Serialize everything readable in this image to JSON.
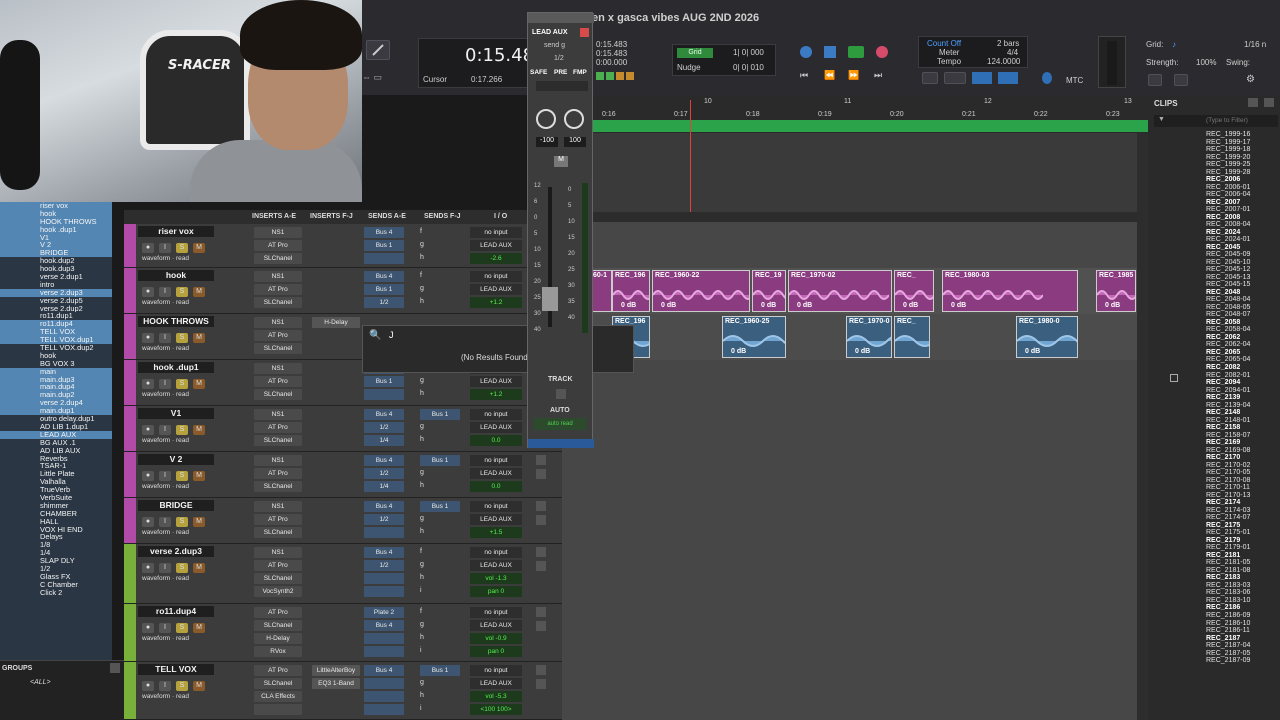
{
  "session_title": "en x gasca vibes AUG 2ND 2026",
  "webcam": {
    "chair_text": "S-RACER"
  },
  "transport": {
    "main_counter": "0:15.48",
    "cursor_label": "Cursor",
    "cursor_value": "0:17.266",
    "sub_counters": [
      "0:15.483",
      "0:15.483",
      "0:00.000"
    ],
    "grid_label": "Grid",
    "grid_value": "1| 0| 000",
    "nudge_label": "Nudge",
    "nudge_value": "0| 0| 010",
    "count_off": "Count Off",
    "meter_label": "Meter",
    "tempo_label": "Tempo",
    "bars": "2 bars",
    "meter": "4/4",
    "tempo": "124.0000",
    "mtc": "MTC",
    "grid_right": "Grid:",
    "grid_right_value": "1/16 n",
    "strength_label": "Strength:",
    "strength": "100%",
    "swing_label": "Swing:"
  },
  "ruler": {
    "ticks": [
      "0:16",
      "0:17",
      "0:18",
      "0:19",
      "0:20",
      "0:21",
      "0:22",
      "0:23"
    ],
    "bars": [
      "10",
      "11",
      "12",
      "13"
    ]
  },
  "aux_window": {
    "name": "LEAD AUX",
    "send": "send g",
    "ch": "1/2",
    "tabs": [
      "SAFE",
      "PRE",
      "FMP"
    ],
    "pan_left": "-100",
    "pan_right": "100",
    "mute": "M",
    "scale": [
      "12",
      "6",
      "0",
      "5",
      "10",
      "15",
      "20",
      "25",
      "30",
      "40"
    ],
    "meter_scale": [
      "0",
      "5",
      "10",
      "15",
      "20",
      "25",
      "30",
      "35",
      "40"
    ],
    "track": "TRACK",
    "auto": "AUTO",
    "auto_mode": "auto read"
  },
  "search_popup": {
    "query": "J",
    "result": "(No Results Found)"
  },
  "mix_headers": [
    "INSERTS A-E",
    "INSERTS F-J",
    "SENDS A-E",
    "SENDS F-J",
    "I / O"
  ],
  "tracks": [
    {
      "name": "riser vox",
      "color": "#b24aa8",
      "inserts": [
        "NS1",
        "AT Pro",
        "SLChanel"
      ],
      "ins_fj": [],
      "sends": [
        "Bus 4",
        "Bus 1",
        ""
      ],
      "send_letters": [
        "f",
        "g",
        "h"
      ],
      "sends_fj": [],
      "io": [
        "no input",
        "LEAD AUX"
      ],
      "vol": "-2.6",
      "pan": "0"
    },
    {
      "name": "hook",
      "color": "#b24aa8",
      "inserts": [
        "NS1",
        "AT Pro",
        "SLChanel"
      ],
      "ins_fj": [],
      "sends": [
        "Bus 4",
        "Bus 1",
        "1/2"
      ],
      "send_letters": [
        "f",
        "g",
        "h"
      ],
      "sends_fj": [],
      "io": [
        "no input",
        "LEAD AUX"
      ],
      "vol": "+1.2",
      "pan": "0"
    },
    {
      "name": "HOOK THROWS",
      "color": "#b24aa8",
      "inserts": [
        "NS1",
        "AT Pro",
        "SLChanel"
      ],
      "ins_fj": [
        "H-Delay"
      ],
      "sends": [],
      "send_letters": [],
      "sends_fj": [],
      "io": [],
      "vol": "",
      "pan": ""
    },
    {
      "name": "hook .dup1",
      "color": "#b24aa8",
      "inserts": [
        "NS1",
        "AT Pro",
        "SLChanel"
      ],
      "ins_fj": [],
      "sends": [
        "",
        "Bus 1",
        ""
      ],
      "send_letters": [
        "f",
        "g",
        "h"
      ],
      "sends_fj": [],
      "io": [
        "",
        "LEAD AUX"
      ],
      "vol": "+1.2",
      "pan": "0"
    },
    {
      "name": "V1",
      "color": "#b24aa8",
      "inserts": [
        "NS1",
        "AT Pro",
        "SLChanel"
      ],
      "ins_fj": [],
      "sends": [
        "Bus 4",
        "1/2",
        "1/4"
      ],
      "send_letters": [
        "f",
        "g",
        "h"
      ],
      "sends_fj": [
        "Bus 1"
      ],
      "io": [
        "no input",
        "LEAD AUX"
      ],
      "vol": "0.0",
      "pan": "0"
    },
    {
      "name": "V 2",
      "color": "#b24aa8",
      "inserts": [
        "NS1",
        "AT Pro",
        "SLChanel"
      ],
      "ins_fj": [],
      "sends": [
        "Bus 4",
        "1/2",
        "1/4"
      ],
      "send_letters": [
        "f",
        "g",
        "h"
      ],
      "sends_fj": [
        "Bus 1"
      ],
      "io": [
        "no input",
        "LEAD AUX"
      ],
      "vol": "0.0",
      "pan": "0"
    },
    {
      "name": "BRIDGE",
      "color": "#b24aa8",
      "inserts": [
        "NS1",
        "AT Pro",
        "SLChanel"
      ],
      "ins_fj": [],
      "sends": [
        "Bus 4",
        "1/2",
        ""
      ],
      "send_letters": [
        "f",
        "g",
        "h"
      ],
      "sends_fj": [
        "Bus 1"
      ],
      "io": [
        "no input",
        "LEAD AUX"
      ],
      "vol": "+1.5",
      "pan": "0"
    },
    {
      "name": "verse 2.dup3",
      "color": "#79b03a",
      "inserts": [
        "NS1",
        "AT Pro",
        "SLChanel",
        "VocSynth2"
      ],
      "ins_fj": [],
      "sends": [
        "Bus 4",
        "1/2",
        "",
        ""
      ],
      "send_letters": [
        "f",
        "g",
        "h",
        "i"
      ],
      "sends_fj": [],
      "io": [
        "no input",
        "LEAD AUX"
      ],
      "vol": "vol -1.3",
      "pan": "pan 0"
    },
    {
      "name": "ro11.dup4",
      "color": "#79b03a",
      "inserts": [
        "AT Pro",
        "SLChanel",
        "H-Delay",
        "RVox"
      ],
      "ins_fj": [],
      "sends": [
        "Plate 2",
        "Bus 4",
        "",
        ""
      ],
      "send_letters": [
        "f",
        "g",
        "h",
        "i"
      ],
      "sends_fj": [],
      "io": [
        "no input",
        "LEAD AUX"
      ],
      "vol": "vol -0.9",
      "pan": "pan 0"
    },
    {
      "name": "TELL VOX",
      "color": "#79b03a",
      "inserts": [
        "AT Pro",
        "SLChanel",
        "CLA Effects",
        ""
      ],
      "ins_fj": [
        "LittleAlterBoy",
        "EQ3 1-Band"
      ],
      "sends": [
        "Bus 4",
        "",
        "",
        ""
      ],
      "send_letters": [
        "f",
        "g",
        "h",
        "i"
      ],
      "sends_fj": [
        "Bus 1"
      ],
      "io": [
        "no input",
        "LEAD AUX"
      ],
      "vol": "vol -5.3",
      "pan": "<100 100>"
    }
  ],
  "tracklist": [
    {
      "t": "riser vox",
      "s": true
    },
    {
      "t": "hook",
      "s": true
    },
    {
      "t": "HOOK THROWS",
      "s": true
    },
    {
      "t": "hook .dup1",
      "s": true
    },
    {
      "t": "V1",
      "s": true
    },
    {
      "t": "V 2",
      "s": true
    },
    {
      "t": "BRIDGE",
      "s": true
    },
    {
      "t": "hook.dup2",
      "s": false
    },
    {
      "t": "hook.dup3",
      "s": false
    },
    {
      "t": "verse 2.dup1",
      "s": false
    },
    {
      "t": "intro",
      "s": false
    },
    {
      "t": "verse 2.dup3",
      "s": true
    },
    {
      "t": "verse 2.dup5",
      "s": false
    },
    {
      "t": "verse 2.dup2",
      "s": false
    },
    {
      "t": "ro11.dup1",
      "s": false
    },
    {
      "t": "ro11.dup4",
      "s": true
    },
    {
      "t": "TELL VOX",
      "s": true
    },
    {
      "t": "TELL VOX.dup1",
      "s": true
    },
    {
      "t": "TELL VOX.dup2",
      "s": false
    },
    {
      "t": "hook",
      "s": false
    },
    {
      "t": "BG VOX 3",
      "s": false
    },
    {
      "t": "main",
      "s": true
    },
    {
      "t": "main.dup3",
      "s": true
    },
    {
      "t": "main.dup4",
      "s": true
    },
    {
      "t": "main.dup2",
      "s": true
    },
    {
      "t": "verse 2.dup4",
      "s": true
    },
    {
      "t": "main.dup1",
      "s": true
    },
    {
      "t": "outro delay.dup1",
      "s": false
    },
    {
      "t": "AD LIB 1.dup1",
      "s": false
    },
    {
      "t": "LEAD AUX",
      "s": true
    },
    {
      "t": "BG AUX .1",
      "s": false
    },
    {
      "t": "AD LIB AUX",
      "s": false
    },
    {
      "t": "Reverbs",
      "s": false
    },
    {
      "t": "TSAR-1",
      "s": false
    },
    {
      "t": "Little Plate",
      "s": false
    },
    {
      "t": "Valhalla",
      "s": false
    },
    {
      "t": "TrueVerb",
      "s": false
    },
    {
      "t": "VerbSuite",
      "s": false
    },
    {
      "t": "shimmer",
      "s": false
    },
    {
      "t": "CHAMBER",
      "s": false
    },
    {
      "t": "HALL",
      "s": false
    },
    {
      "t": "VOX HI END",
      "s": false
    },
    {
      "t": "Delays",
      "s": false
    },
    {
      "t": "1/8",
      "s": false
    },
    {
      "t": "1/4",
      "s": false
    },
    {
      "t": "SLAP DLY",
      "s": false
    },
    {
      "t": "1/2",
      "s": false
    },
    {
      "t": "Glass FX",
      "s": false
    },
    {
      "t": "C Chamber",
      "s": false
    },
    {
      "t": "Click 2",
      "s": false
    }
  ],
  "groups": {
    "title": "GROUPS",
    "all": "<ALL>"
  },
  "clips_panel": {
    "title": "CLIPS",
    "filter_placeholder": "(Type to Filter)",
    "items": [
      {
        "t": "REC_1999-16",
        "b": false
      },
      {
        "t": "REC_1999-17",
        "b": false
      },
      {
        "t": "REC_1999-18",
        "b": false
      },
      {
        "t": "REC_1999-20",
        "b": false
      },
      {
        "t": "REC_1999-25",
        "b": false
      },
      {
        "t": "REC_1999-28",
        "b": false
      },
      {
        "t": "REC_2006",
        "b": true
      },
      {
        "t": "REC_2006-01",
        "b": false
      },
      {
        "t": "REC_2006-04",
        "b": false
      },
      {
        "t": "REC_2007",
        "b": true
      },
      {
        "t": "REC_2007-01",
        "b": false
      },
      {
        "t": "REC_2008",
        "b": true
      },
      {
        "t": "REC_2008-04",
        "b": false
      },
      {
        "t": "REC_2024",
        "b": true
      },
      {
        "t": "REC_2024-01",
        "b": false
      },
      {
        "t": "REC_2045",
        "b": true
      },
      {
        "t": "REC_2045-09",
        "b": false
      },
      {
        "t": "REC_2045-10",
        "b": false
      },
      {
        "t": "REC_2045-12",
        "b": false
      },
      {
        "t": "REC_2045-13",
        "b": false
      },
      {
        "t": "REC_2045-15",
        "b": false
      },
      {
        "t": "REC_2048",
        "b": true
      },
      {
        "t": "REC_2048-04",
        "b": false
      },
      {
        "t": "REC_2048-05",
        "b": false
      },
      {
        "t": "REC_2048-07",
        "b": false
      },
      {
        "t": "REC_2058",
        "b": true
      },
      {
        "t": "REC_2058-04",
        "b": false
      },
      {
        "t": "REC_2062",
        "b": true
      },
      {
        "t": "REC_2062-04",
        "b": false
      },
      {
        "t": "REC_2065",
        "b": true
      },
      {
        "t": "REC_2065-04",
        "b": false
      },
      {
        "t": "REC_2082",
        "b": true
      },
      {
        "t": "REC_2082-01",
        "b": false
      },
      {
        "t": "REC_2094",
        "b": true
      },
      {
        "t": "REC_2094-01",
        "b": false
      },
      {
        "t": "REC_2139",
        "b": true
      },
      {
        "t": "REC_2139-04",
        "b": false
      },
      {
        "t": "REC_2148",
        "b": true
      },
      {
        "t": "REC_2148-01",
        "b": false
      },
      {
        "t": "REC_2158",
        "b": true
      },
      {
        "t": "REC_2158-07",
        "b": false
      },
      {
        "t": "REC_2169",
        "b": true
      },
      {
        "t": "REC_2169-08",
        "b": false
      },
      {
        "t": "REC_2170",
        "b": true
      },
      {
        "t": "REC_2170-02",
        "b": false
      },
      {
        "t": "REC_2170-05",
        "b": false
      },
      {
        "t": "REC_2170-08",
        "b": false
      },
      {
        "t": "REC_2170-11",
        "b": false
      },
      {
        "t": "REC_2170-13",
        "b": false
      },
      {
        "t": "REC_2174",
        "b": true
      },
      {
        "t": "REC_2174-03",
        "b": false
      },
      {
        "t": "REC_2174-07",
        "b": false
      },
      {
        "t": "REC_2175",
        "b": true
      },
      {
        "t": "REC_2175-01",
        "b": false
      },
      {
        "t": "REC_2179",
        "b": true
      },
      {
        "t": "REC_2179-01",
        "b": false
      },
      {
        "t": "REC_2181",
        "b": true
      },
      {
        "t": "REC_2181-05",
        "b": false
      },
      {
        "t": "REC_2181-08",
        "b": false
      },
      {
        "t": "REC_2183",
        "b": true
      },
      {
        "t": "REC_2183-03",
        "b": false
      },
      {
        "t": "REC_2183-06",
        "b": false
      },
      {
        "t": "REC_2183-10",
        "b": false
      },
      {
        "t": "REC_2186",
        "b": true
      },
      {
        "t": "REC_2186-09",
        "b": false
      },
      {
        "t": "REC_2186-10",
        "b": false
      },
      {
        "t": "REC_2186-11",
        "b": false
      },
      {
        "t": "REC_2187",
        "b": true
      },
      {
        "t": "REC_2187-04",
        "b": false
      },
      {
        "t": "REC_2187-05",
        "b": false
      },
      {
        "t": "REC_2187-09",
        "b": false
      }
    ]
  },
  "clips_row1": [
    {
      "name": "REC_196",
      "db": "0 dB"
    },
    {
      "name": "REC_1960-22",
      "db": "0 dB"
    },
    {
      "name": "REC_19",
      "db": "0 dB"
    },
    {
      "name": "REC_1970-02",
      "db": "0 dB"
    },
    {
      "name": "REC_",
      "db": "0 dB"
    },
    {
      "name": "REC_1980-03",
      "db": "0 dB"
    },
    {
      "name": "REC_1985",
      "db": "0 dB"
    }
  ],
  "clips_row1_partial": "60-1",
  "clips_row2": [
    {
      "name": "REC_196",
      "db": "3"
    },
    {
      "name": "REC_1960-25",
      "db": "0 dB"
    },
    {
      "name": "REC_1970-0",
      "db": "0 dB"
    },
    {
      "name": "REC_",
      "db": ""
    },
    {
      "name": "REC_1980-0",
      "db": "0 dB"
    }
  ]
}
